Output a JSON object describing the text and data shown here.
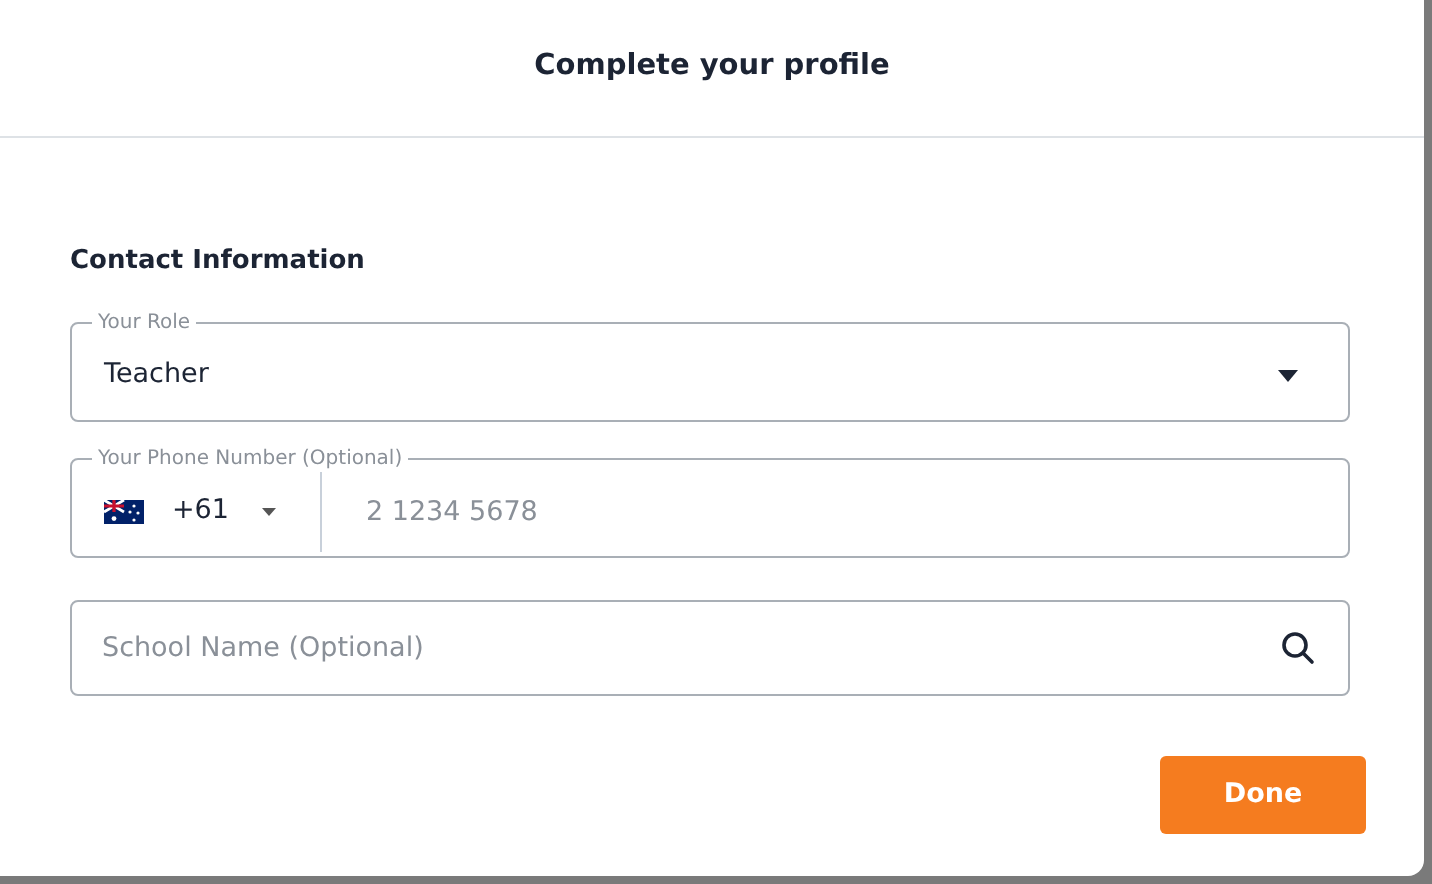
{
  "dialog": {
    "title": "Complete your profile"
  },
  "section": {
    "title": "Contact Information"
  },
  "role_field": {
    "label": "Your Role",
    "value": "Teacher"
  },
  "phone_field": {
    "label": "Your Phone Number (Optional)",
    "country_code": "+61",
    "placeholder": "2 1234 5678"
  },
  "school_field": {
    "placeholder": "School Name (Optional)"
  },
  "buttons": [
    "Done"
  ]
}
